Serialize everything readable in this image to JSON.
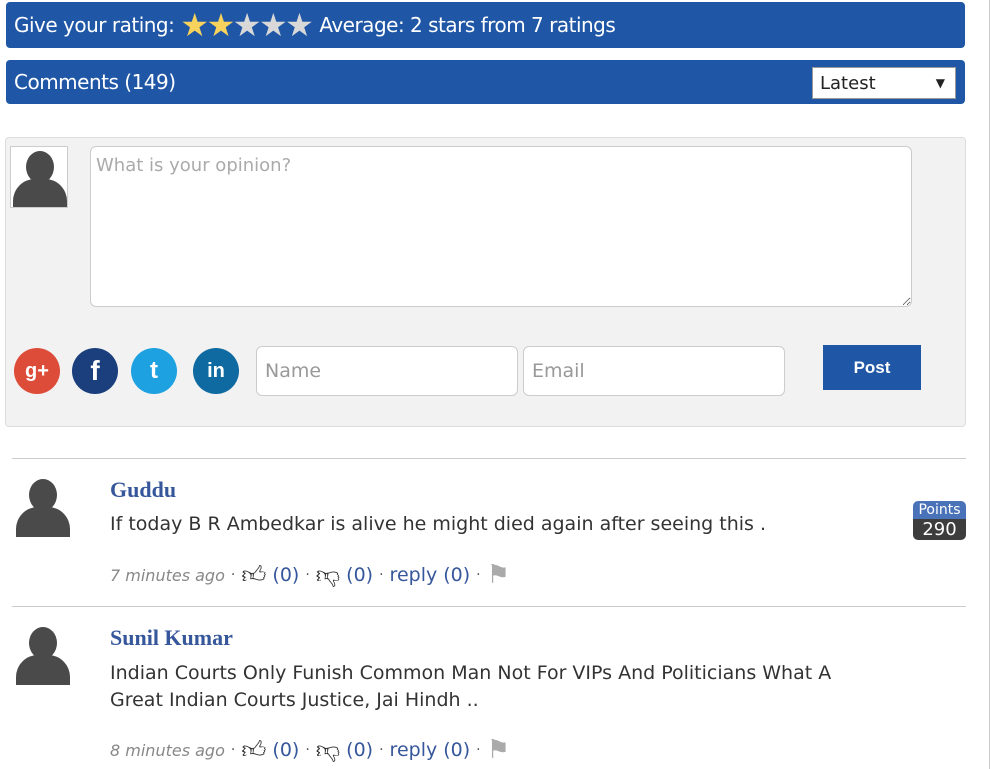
{
  "rating": {
    "label": "Give your rating:",
    "stars_filled": 2,
    "stars_total": 5,
    "average_text": "Average: 2 stars from 7 ratings",
    "colors": {
      "filled": "#f7d25c",
      "empty": "#d8d8d8"
    }
  },
  "comments_header": {
    "title": "Comments (149)",
    "sort_selected": "Latest"
  },
  "form": {
    "placeholder": "What is your opinion?",
    "name_placeholder": "Name",
    "email_placeholder": "Email",
    "post_label": "Post",
    "social": {
      "google": "g+",
      "facebook": "f",
      "twitter": "t",
      "linkedin": "in"
    }
  },
  "comments": [
    {
      "name": "Guddu",
      "text": "If today B R Ambedkar is alive he might died again after seeing this .",
      "time": "7 minutes ago",
      "likes": "(0)",
      "dislikes": "(0)",
      "reply": "reply (0)",
      "points_label": "Points",
      "points": "290"
    },
    {
      "name": "Sunil Kumar",
      "text": "Indian Courts Only Funish Common Man Not For VIPs And Politicians What A Great Indian Courts Justice, Jai Hindh ..",
      "time": "8 minutes ago",
      "likes": "(0)",
      "dislikes": "(0)",
      "reply": "reply (0)"
    }
  ],
  "accent": "#1f56a5"
}
